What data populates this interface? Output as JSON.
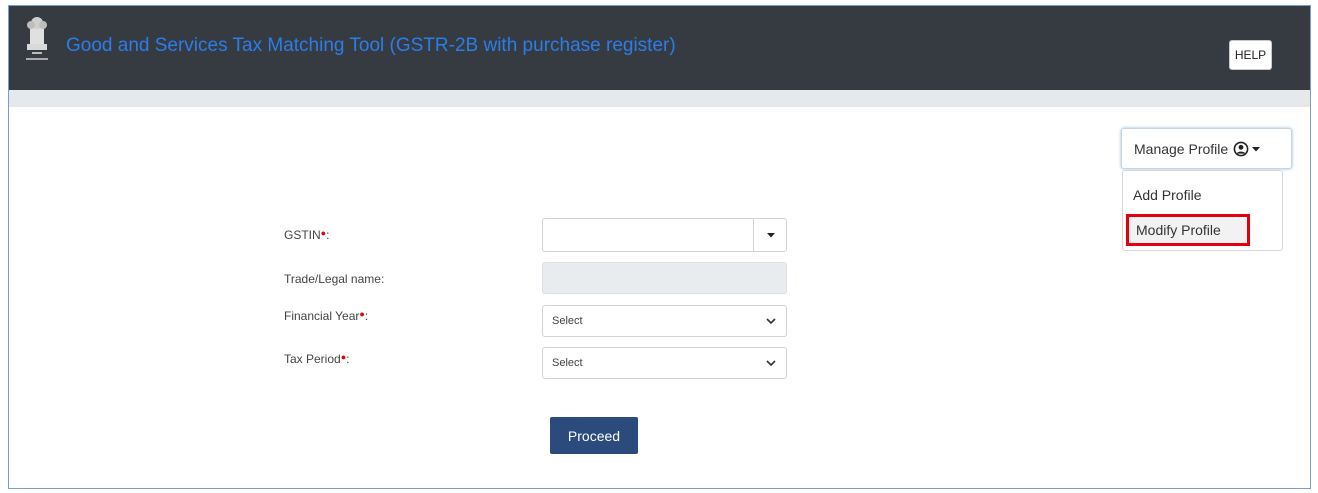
{
  "header": {
    "title": "Good and Services Tax Matching Tool (GSTR-2B with purchase register)",
    "help_label": "HELP",
    "emblem_icon": "national-emblem-icon",
    "background_color": "#363b42",
    "title_color": "#2b7de9"
  },
  "profile": {
    "manage_label": "Manage Profile",
    "menu": {
      "add": "Add Profile",
      "modify": "Modify Profile"
    },
    "highlight_color": "#e3000f"
  },
  "form": {
    "gstin_label": "GSTIN",
    "gstin_value": "",
    "trade_label": "Trade/Legal name:",
    "trade_value": "",
    "fy_label": "Financial Year",
    "fy_selected": "Select",
    "tax_period_label": "Tax Period",
    "tax_period_selected": "Select",
    "colon": ":"
  },
  "actions": {
    "proceed": "Proceed",
    "proceed_color": "#2a4b7c"
  }
}
